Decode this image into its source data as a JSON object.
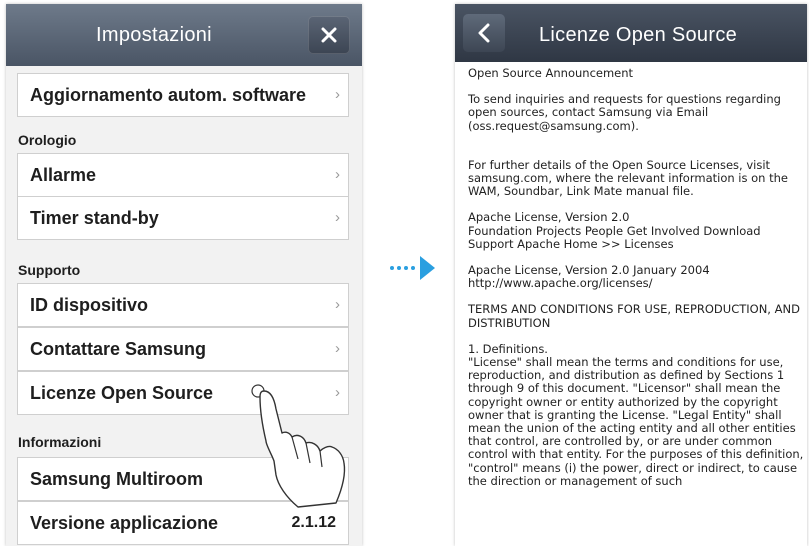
{
  "left_screen": {
    "title": "Impostazioni",
    "top_item": {
      "label": "Aggiornamento autom. software"
    },
    "sections": {
      "clock": "Orologio",
      "support": "Supporto",
      "info": "Informazioni"
    },
    "items": {
      "alarm": "Allarme",
      "standby": "Timer stand-by",
      "device_id": "ID dispositivo",
      "contact": "Contattare Samsung",
      "open_source": "Licenze Open Source",
      "multiroom": "Samsung Multiroom",
      "app_version": "Versione applicazione"
    },
    "app_version_value": "2.1.12",
    "chevron": "›"
  },
  "right_screen": {
    "title": "Licenze Open Source",
    "paragraphs": [
      "Open Source Announcement",
      "To send inquiries and requests for questions regarding open sources, contact Samsung via Email (oss.request@samsung.com).",
      "For further details of the Open Source Licenses, visit samsung.com, where the relevant information is on the WAM, Soundbar, Link Mate manual file.",
      "Apache License, Version 2.0\nFoundation Projects People Get Involved Download Support Apache Home >> Licenses",
      "Apache License, Version 2.0 January 2004\nhttp://www.apache.org/licenses/",
      "TERMS AND CONDITIONS FOR USE, REPRODUCTION, AND DISTRIBUTION",
      "1. Definitions.\n\"License\" shall mean the terms and conditions for use, reproduction, and distribution as defined by Sections 1 through 9 of this document. \"Licensor\" shall mean the copyright owner or entity authorized by the copyright owner that is granting the License. \"Legal Entity\" shall mean the union of the acting entity and all other entities that control, are controlled by, or are under common control with that entity. For the purposes of this definition, \"control\" means (i) the power, direct or indirect, to cause the direction or management of such"
    ]
  },
  "colors": {
    "header_left": "#5a6575",
    "header_right": "#3c4554",
    "arrow": "#2a9fe0"
  }
}
